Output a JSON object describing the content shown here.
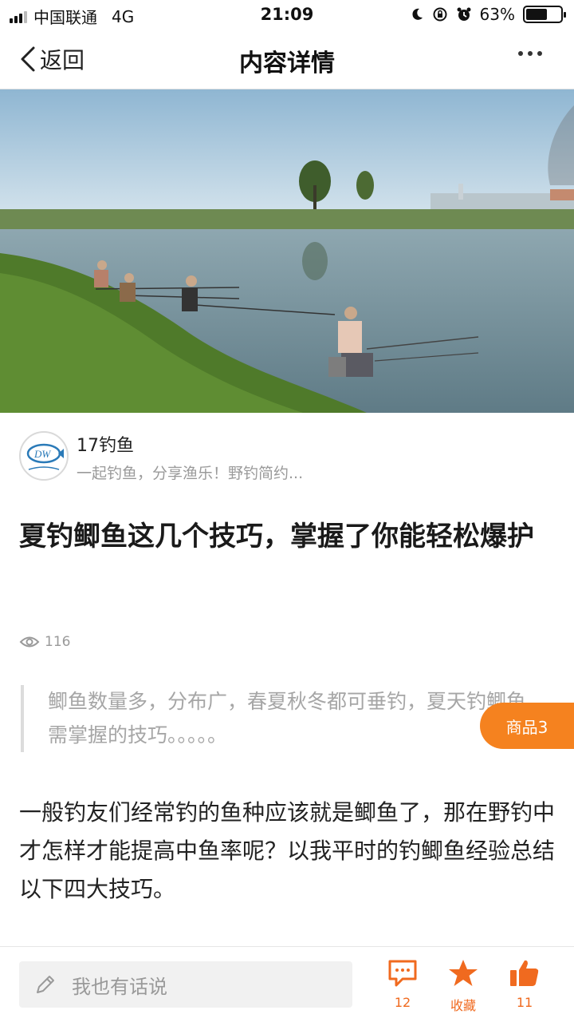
{
  "status_bar": {
    "carrier": "中国联通",
    "network": "4G",
    "time": "21:09",
    "battery_percent": "63%",
    "battery_level": 0.63
  },
  "nav": {
    "back_label": "返回",
    "title": "内容详情"
  },
  "author": {
    "name": "17钓鱼",
    "description": "一起钓鱼，分享渔乐！野钓简约..."
  },
  "article": {
    "title": "夏钓鲫鱼这几个技巧，掌握了你能轻松爆护",
    "views": "116",
    "summary": "鲫鱼数量多，分布广，春夏秋冬都可垂钓，夏天钓鲫鱼，需掌握的技巧。。。。。",
    "body": "一般钓友们经常钓的鱼种应该就是鲫鱼了，那在野钓中才怎样才能提高中鱼率呢？以我平时的钓鲫鱼经验总结以下四大技巧。"
  },
  "goods_badge": "商品3",
  "bottom_bar": {
    "comment_placeholder": "我也有话说",
    "comment_count": "12",
    "favorite_label": "收藏",
    "like_count": "11"
  },
  "colors": {
    "accent": "#f5821f",
    "icon_accent": "#f06a1f"
  }
}
